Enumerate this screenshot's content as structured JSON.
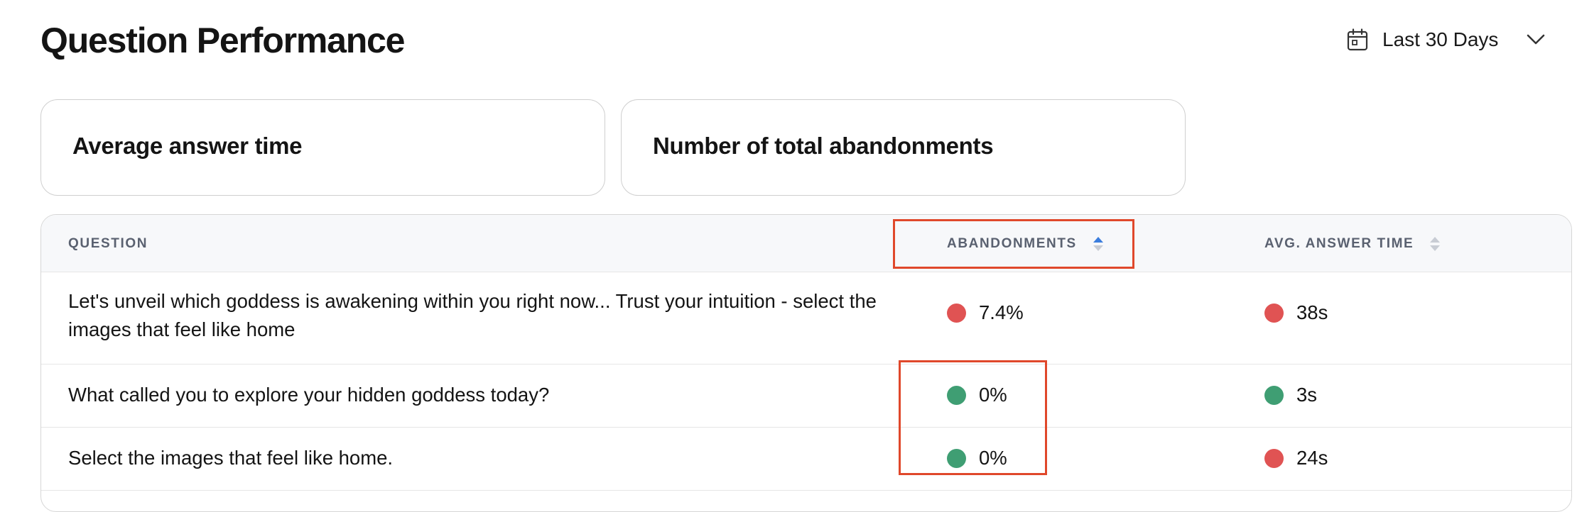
{
  "header": {
    "title": "Question Performance",
    "date_range": {
      "label": "Last 30 Days",
      "icon": "calendar-icon",
      "dropdown_icon": "chevron-down-icon"
    }
  },
  "cards": [
    {
      "title": "Average answer time"
    },
    {
      "title": "Number of total abandonments"
    }
  ],
  "table": {
    "columns": [
      {
        "label": "QUESTION"
      },
      {
        "label": "ABANDONMENTS",
        "sort": "ascending"
      },
      {
        "label": "AVG. ANSWER TIME",
        "sort": "none"
      }
    ],
    "rows": [
      {
        "question": "Let's unveil which goddess is awakening within you right now... Trust your intuition - select the images that feel like home",
        "abandonments": {
          "value": "7.4%",
          "status": "red"
        },
        "avg_answer_time": {
          "value": "38s",
          "status": "red"
        }
      },
      {
        "question": "What called you to explore your hidden goddess today?",
        "abandonments": {
          "value": "0%",
          "status": "green"
        },
        "avg_answer_time": {
          "value": "3s",
          "status": "green"
        }
      },
      {
        "question": "Select the images that feel like home.",
        "abandonments": {
          "value": "0%",
          "status": "green"
        },
        "avg_answer_time": {
          "value": "24s",
          "status": "red"
        }
      }
    ]
  },
  "colors": {
    "status_red": "#e05353",
    "status_green": "#3f9e73",
    "sort_active": "#3b7ddd",
    "sort_inactive": "#c8ccd4",
    "highlight": "#e0482b"
  }
}
